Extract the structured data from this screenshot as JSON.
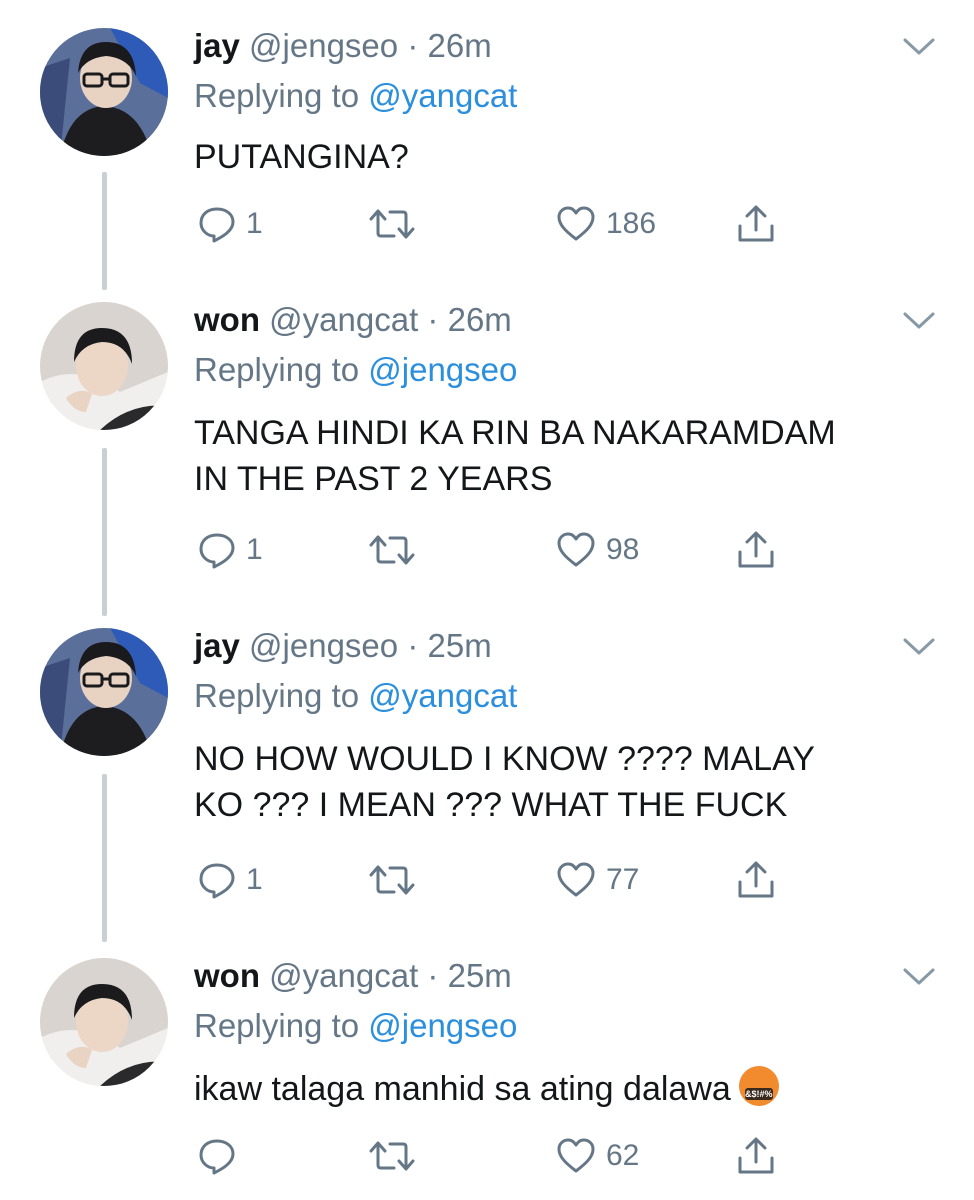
{
  "thread": [
    {
      "name": "jay",
      "handle": "@jengseo",
      "dot": "·",
      "time": "26m",
      "replying_prefix": "Replying to ",
      "replying_to": "@yangcat",
      "lines": [
        "PUTANGINA?"
      ],
      "replies": "1",
      "retweets": "",
      "likes": "186",
      "avatar": "jay-avatar"
    },
    {
      "name": "won",
      "handle": "@yangcat",
      "dot": "·",
      "time": "26m",
      "replying_prefix": "Replying to ",
      "replying_to": "@jengseo",
      "lines": [
        "TANGA HINDI KA RIN BA NAKARAMDAM",
        "IN THE PAST 2 YEARS"
      ],
      "replies": "1",
      "retweets": "",
      "likes": "98",
      "avatar": "won-avatar"
    },
    {
      "name": "jay",
      "handle": "@jengseo",
      "dot": "·",
      "time": "25m",
      "replying_prefix": "Replying to ",
      "replying_to": "@yangcat",
      "lines": [
        "NO HOW WOULD I KNOW ???? MALAY",
        "KO ??? I MEAN ??? WHAT THE FUCK"
      ],
      "replies": "1",
      "retweets": "",
      "likes": "77",
      "avatar": "jay-avatar"
    },
    {
      "name": "won",
      "handle": "@yangcat",
      "dot": "·",
      "time": "25m",
      "replying_prefix": "Replying to ",
      "replying_to": "@jengseo",
      "lines": [
        "ikaw talaga manhid sa ating dalawa"
      ],
      "emoji": "&$!#%",
      "replies": "",
      "retweets": "",
      "likes": "62",
      "avatar": "won-avatar"
    }
  ],
  "icons": {
    "reply": "reply-icon",
    "retweet": "retweet-icon",
    "like": "heart-icon",
    "share": "share-icon",
    "menu": "chevron-down-icon"
  },
  "colors": {
    "name": "#14171a",
    "muted": "#657786",
    "mention": "#2b8fde",
    "thread_line": "#c8d0d6",
    "emoji": "#f28a2e"
  }
}
